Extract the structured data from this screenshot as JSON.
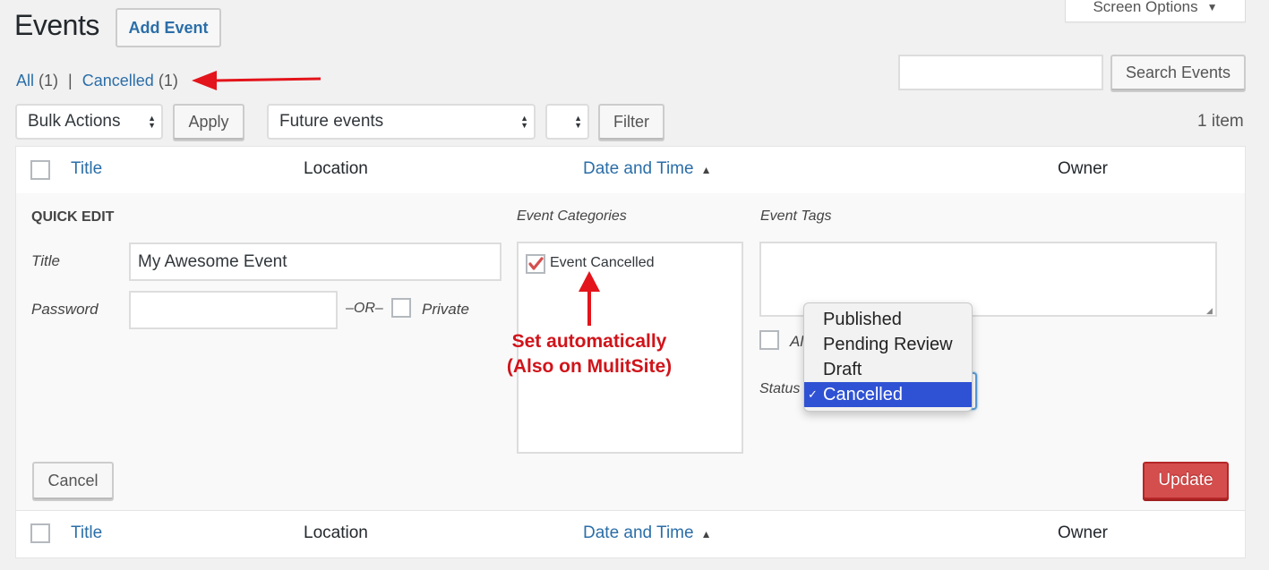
{
  "header": {
    "title": "Events",
    "add_button": "Add Event",
    "screen_options": "Screen Options",
    "screen_options_icon": "triangle-down"
  },
  "views": {
    "all_label": "All",
    "all_count": "(1)",
    "separator": "|",
    "cancelled_label": "Cancelled",
    "cancelled_count": "(1)"
  },
  "search": {
    "value": "",
    "placeholder": "",
    "button": "Search Events"
  },
  "tablenav": {
    "bulk_actions": "Bulk Actions",
    "apply": "Apply",
    "scope_filter": "Future events",
    "secondary_filter": "",
    "filter": "Filter",
    "item_count": "1 item"
  },
  "columns": {
    "title": "Title",
    "location": "Location",
    "date_time": "Date and Time",
    "sort_indicator": "▲",
    "owner": "Owner"
  },
  "quick_edit": {
    "heading": "QUICK EDIT",
    "title_label": "Title",
    "title_value": "My Awesome Event",
    "password_label": "Password",
    "password_value": "",
    "or_text": "–OR–",
    "private_label": "Private",
    "private_checked": false,
    "categories_label": "Event Categories",
    "categories": [
      {
        "label": "Event Cancelled",
        "checked": true
      }
    ],
    "tags_label": "Event Tags",
    "tags_value": "",
    "allow_label_partial": "Al",
    "status_label": "Status",
    "status_options": [
      "Published",
      "Pending Review",
      "Draft",
      "Cancelled"
    ],
    "status_selected": "Cancelled",
    "cancel_button": "Cancel",
    "update_button": "Update"
  },
  "annotation": {
    "line1": "Set automatically",
    "line2": "(Also on MulitSite)",
    "color": "#d0141a"
  },
  "colors": {
    "link": "#2b6ea8",
    "update_button": "#d54e4e",
    "dropdown_highlight": "#2f52d4"
  }
}
